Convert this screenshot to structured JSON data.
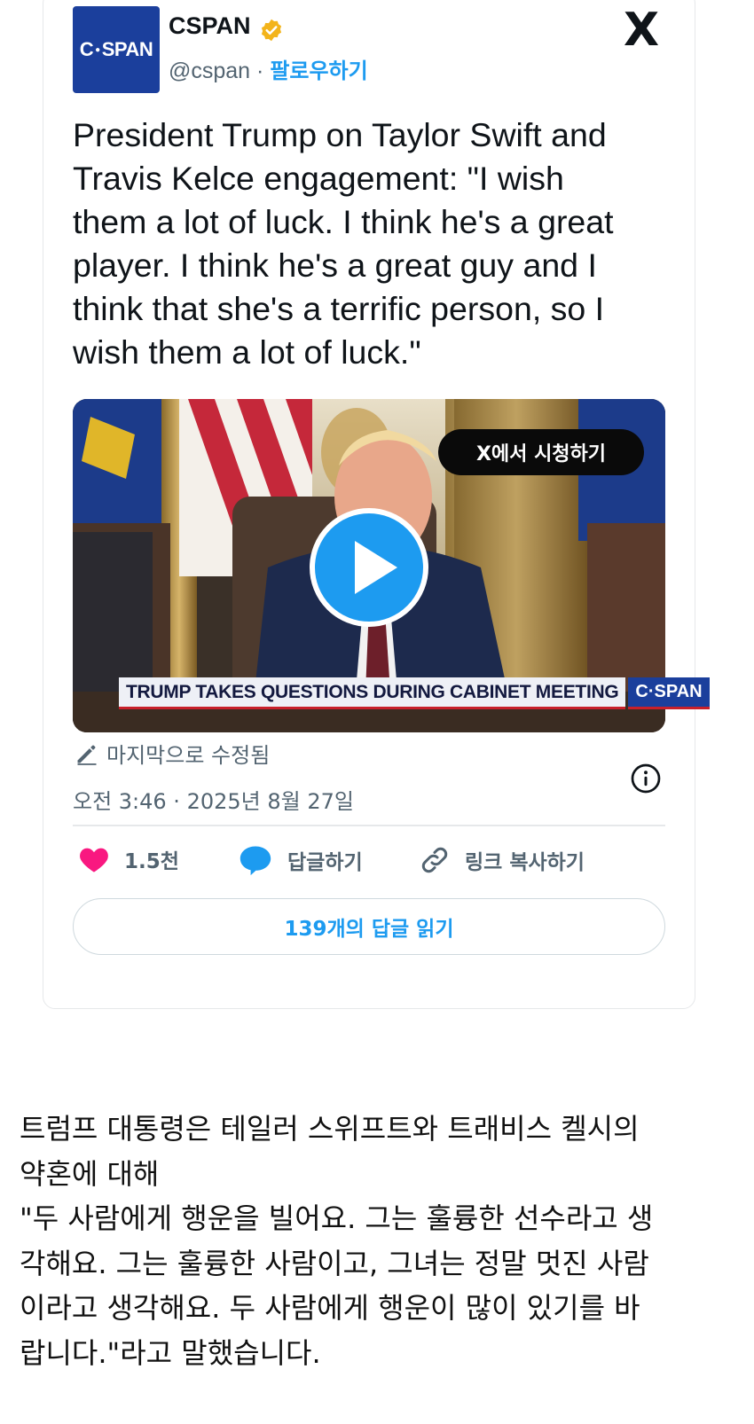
{
  "account": {
    "logo_text_left": "C",
    "logo_text_right": "SPAN",
    "name": "CSPAN",
    "handle": "@cspan",
    "separator": " · ",
    "follow_label": "팔로우하기",
    "x_logo": "X",
    "verified_color": "#f3b41b"
  },
  "tweet": {
    "lines": [
      "President Trump on Taylor Swift and",
      "Travis Kelce engagement: \"I wish",
      "them a lot of luck. I think he's a great",
      "player. I think he's a great guy and I",
      "think that she's a terrific person, so I",
      "wish them a lot of luck.\""
    ]
  },
  "video": {
    "watch_label": "X에서 시청하기",
    "lower_third_text": "TRUMP TAKES QUESTIONS DURING CABINET MEETING",
    "lower_third_brand": "C·SPAN"
  },
  "meta": {
    "edited_label": "마지막으로 수정됨",
    "timestamp": "오전 3:46 · 2025년 8월 27일"
  },
  "actions": {
    "likes": "1.5천",
    "reply_label": "답글하기",
    "copy_link_label": "링크 복사하기",
    "read_replies_label": "139개의 답글 읽기"
  },
  "caption": {
    "lines": [
      "트럼프 대통령은 테일러 스위프트와 트래비스 켈시의",
      "약혼에 대해",
      "\"두 사람에게 행운을 빌어요. 그는 훌륭한 선수라고 생",
      "각해요. 그는 훌륭한 사람이고, 그녀는 정말 멋진 사람",
      "이라고 생각해요. 두 사람에게 행운이 많이 있기를 바",
      "랍니다.\"라고 말했습니다."
    ]
  },
  "colors": {
    "brand_blue": "#1d9bf0",
    "like_pink": "#f91880",
    "cspan_blue": "#1b3f9c",
    "muted_text": "#536471"
  }
}
